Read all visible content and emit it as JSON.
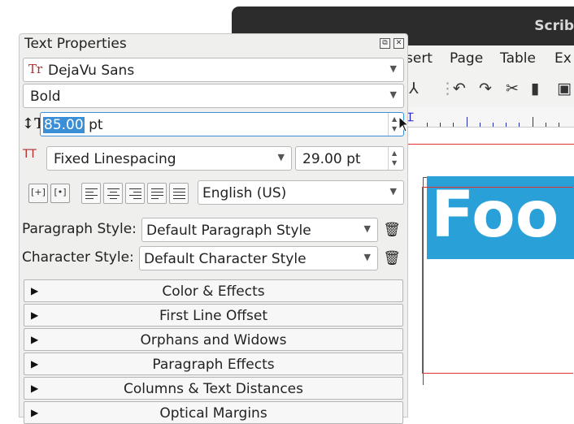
{
  "background_window": {
    "title": "Scrib",
    "menu": [
      {
        "label": "sert"
      },
      {
        "label": "Page"
      },
      {
        "label": "Table"
      },
      {
        "label": "Ex"
      }
    ],
    "frame_text": "Foo"
  },
  "panel": {
    "title": "Text Properties",
    "font_family": "DejaVu Sans",
    "font_style": "Bold",
    "font_size_selected": "85.00",
    "font_size_unit": "pt",
    "linespacing_mode": "Fixed Linespacing",
    "linespacing_value": "29.00 pt",
    "language": "English (US)",
    "paragraph_style_label": "Paragraph Style:",
    "paragraph_style_value": "Default Paragraph Style",
    "character_style_label": "Character Style:",
    "character_style_value": "Default Character Style",
    "sections": [
      {
        "label": "Color & Effects"
      },
      {
        "label": "First Line Offset"
      },
      {
        "label": "Orphans and Widows"
      },
      {
        "label": "Paragraph Effects"
      },
      {
        "label": "Columns & Text Distances"
      },
      {
        "label": "Optical Margins"
      }
    ]
  },
  "colors": {
    "accent": "#2aa0d8",
    "selection": "#3a8fd6",
    "guide_red": "#e03030",
    "titlebar": "#2c2c2c"
  },
  "icons": [
    "font-icon",
    "font-size-icon",
    "linespacing-icon",
    "trash-icon",
    "expand-triangle-icon",
    "undo-icon",
    "redo-icon",
    "cut-icon",
    "copy-icon",
    "pdf-icon"
  ]
}
